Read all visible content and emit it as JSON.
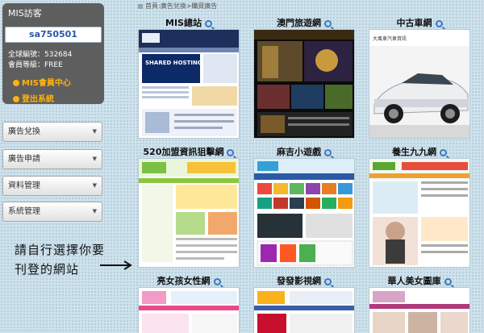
{
  "user_box": {
    "title": "MIS訪客",
    "username": "sa750501",
    "member_no": "全球編號：532684",
    "member_level": "會員等級：FREE",
    "member_center": "MIS會員中心",
    "logout": "登出系統"
  },
  "menu": [
    {
      "label": "廣告兌換"
    },
    {
      "label": "廣告申請"
    },
    {
      "label": "資料管理"
    },
    {
      "label": "系統管理"
    }
  ],
  "note": {
    "line1": "請自行選擇你要",
    "line2": "刊登的網站"
  },
  "breadcrumb": "首頁:廣告兌換>購買廣告",
  "sites": [
    {
      "title": "MIS總站"
    },
    {
      "title": "澳門旅遊網"
    },
    {
      "title": "中古車網"
    },
    {
      "title": "520加盟資訊狙擊網"
    },
    {
      "title": "麻吉小遊戲"
    },
    {
      "title": "養生九九網"
    },
    {
      "title": "亮女孩女性網"
    },
    {
      "title": "發發影視網"
    },
    {
      "title": "華人美女圖庫"
    }
  ],
  "thumbnails": {
    "mis_shared_hosting": "SHARED HOSTING",
    "car_header": "大風車汽車資訊"
  },
  "colors": {
    "accent": "#2a56a8",
    "link": "#ffb20c",
    "panel": "#5e5e5e"
  }
}
